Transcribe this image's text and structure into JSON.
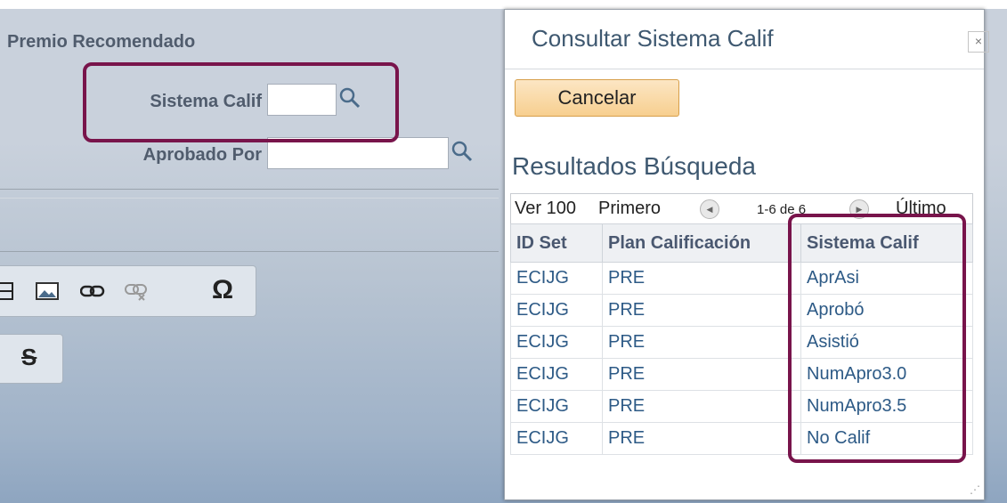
{
  "background_form": {
    "section_title": "Premio Recomendado",
    "grade_system_label": "Sistema Calif",
    "approved_by_label": "Aprobado Por",
    "grade_system_value": "",
    "approved_by_value": ""
  },
  "editor_toolbar": {
    "icons": [
      "table-icon",
      "image-icon",
      "link-icon",
      "unlink-icon",
      "special-character-icon",
      "strikethrough-icon"
    ],
    "omega": "Ω",
    "strike": "S"
  },
  "modal": {
    "title": "Consultar Sistema Calif",
    "close_symbol": "×",
    "cancel_label": "Cancelar",
    "results_title": "Resultados Búsqueda",
    "nav": {
      "view_label": "Ver 100",
      "first_label": "Primero",
      "range": "1-6 de 6",
      "last_label": "Último"
    },
    "columns": [
      "ID Set",
      "Plan Calificación",
      "Sistema Calif"
    ],
    "rows": [
      [
        "ECIJG",
        "PRE",
        "AprAsi"
      ],
      [
        "ECIJG",
        "PRE",
        "Aprobó"
      ],
      [
        "ECIJG",
        "PRE",
        "Asistió"
      ],
      [
        "ECIJG",
        "PRE",
        "NumApro3.0"
      ],
      [
        "ECIJG",
        "PRE",
        "NumApro3.5"
      ],
      [
        "ECIJG",
        "PRE",
        "No Calif"
      ]
    ]
  },
  "colors": {
    "highlight": "#78144b",
    "link_text": "#2d5a86",
    "title_text": "#3e5870",
    "cancel_button": "#f7cf8f"
  }
}
